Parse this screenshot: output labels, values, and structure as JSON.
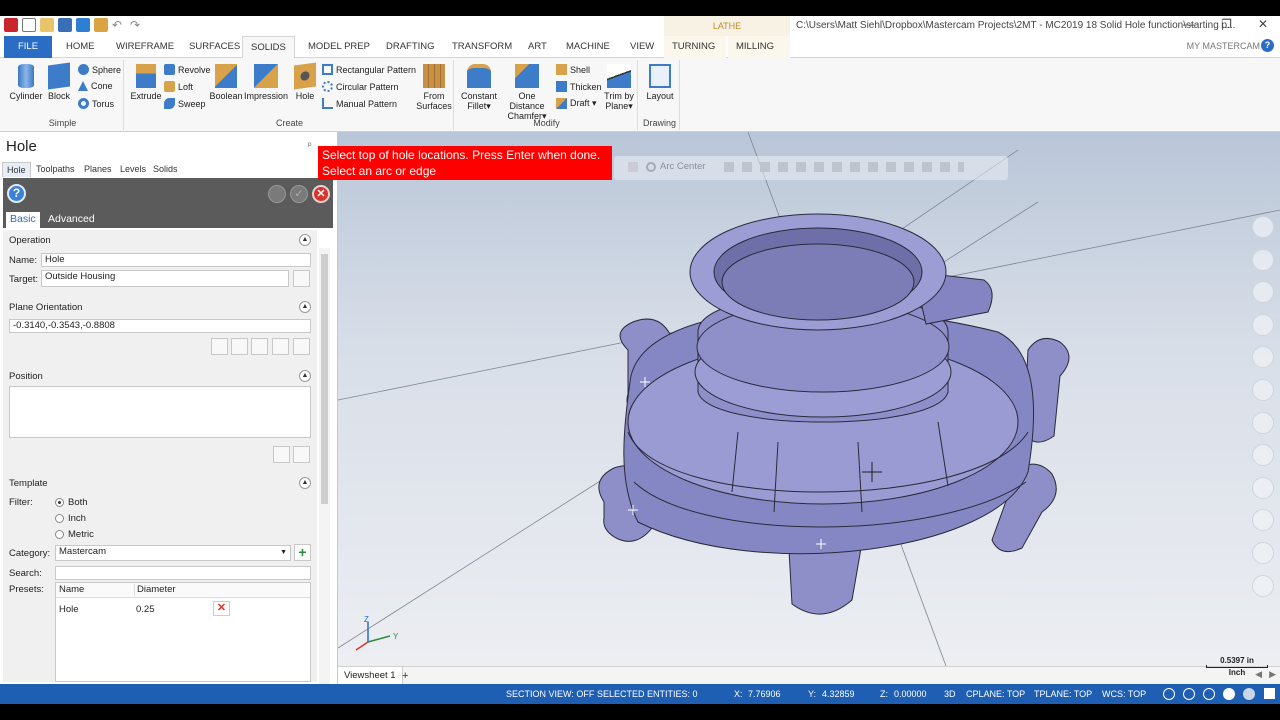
{
  "window": {
    "title": "C:\\Users\\Matt Siehl\\Dropbox\\Mastercam Projects\\2MT - MC2019 18 Solid Hole function\\starting p...",
    "context_tab_group": "LATHE",
    "controls": [
      "—",
      "❐",
      "✕"
    ]
  },
  "tabs": [
    "FILE",
    "HOME",
    "WIREFRAME",
    "SURFACES",
    "SOLIDS",
    "MODEL PREP",
    "DRAFTING",
    "TRANSFORM",
    "ART",
    "MACHINE",
    "VIEW",
    "TURNING",
    "MILLING"
  ],
  "my_mastercam": "MY MASTERCAM",
  "help_symbol": "?",
  "ribbon": {
    "simple": {
      "label": "Simple",
      "cylinder": "Cylinder",
      "block": "Block",
      "sphere": "Sphere",
      "cone": "Cone",
      "torus": "Torus"
    },
    "create": {
      "label": "Create",
      "extrude": "Extrude",
      "revolve": "Revolve",
      "loft": "Loft",
      "sweep": "Sweep",
      "boolean": "Boolean",
      "impression": "Impression",
      "hole": "Hole",
      "rect_pattern": "Rectangular Pattern",
      "circ_pattern": "Circular Pattern",
      "manual_pattern": "Manual Pattern",
      "from_surfaces_1": "From",
      "from_surfaces_2": "Surfaces"
    },
    "modify": {
      "label": "Modify",
      "constant_fillet_1": "Constant",
      "constant_fillet_2": "Fillet▾",
      "one_distance_1": "One Distance",
      "one_distance_2": "Chamfer▾",
      "shell": "Shell",
      "thicken": "Thicken",
      "draft": "Draft ▾",
      "trim_1": "Trim by",
      "trim_2": "Plane▾"
    },
    "drawing": {
      "label": "Drawing",
      "layout": "Layout"
    }
  },
  "panel": {
    "title": "Hole",
    "pin": "ᵖ",
    "tabs": [
      "Hole",
      "Toolpaths",
      "Planes",
      "Levels",
      "Solids"
    ],
    "subtabs": {
      "basic": "Basic",
      "advanced": "Advanced"
    },
    "operation": {
      "title": "Operation",
      "name_label": "Name:",
      "name_value": "Hole",
      "target_label": "Target:",
      "target_value": "Outside Housing"
    },
    "plane": {
      "title": "Plane Orientation",
      "value": "-0.3140,-0.3543,-0.8808"
    },
    "position": {
      "title": "Position"
    },
    "template": {
      "title": "Template",
      "filter_label": "Filter:",
      "filters": [
        "Both",
        "Inch",
        "Metric"
      ],
      "selected_filter": "Both",
      "category_label": "Category:",
      "category_value": "Mastercam",
      "search_label": "Search:",
      "search_value": "",
      "presets_label": "Presets:",
      "preset_columns": [
        "Name",
        "Diameter"
      ],
      "presets": [
        {
          "name": "Hole",
          "diameter": "0.25"
        }
      ]
    }
  },
  "viewport": {
    "prompt_line1": "Select top of hole locations. Press Enter when done.",
    "prompt_line2": "Select an arc or edge",
    "toolbar_label": "Arc Center",
    "scale_value": "0.5397 in",
    "scale_unit": "Inch",
    "axis_z": "Z",
    "axis_y": "Y",
    "viewsheet": "Viewsheet 1",
    "viewsheet_add": "+"
  },
  "status": {
    "section_view": "SECTION VIEW: OFF",
    "selected": "SELECTED ENTITIES: 0",
    "x_label": "X:",
    "x_value": "7.76906",
    "y_label": "Y:",
    "y_value": "4.32859",
    "z_label": "Z:",
    "z_value": "0.00000",
    "mode": "3D",
    "cplane": "CPLANE: TOP",
    "tplane": "TPLANE: TOP",
    "wcs": "WCS: TOP"
  },
  "colors": {
    "accent": "#2b6cc4",
    "status_bar": "#1f5fb3",
    "prompt_bg": "#ff0000",
    "part": "#8e8fc8",
    "cancel": "#d9342b",
    "ok": "#b8b8b8"
  }
}
